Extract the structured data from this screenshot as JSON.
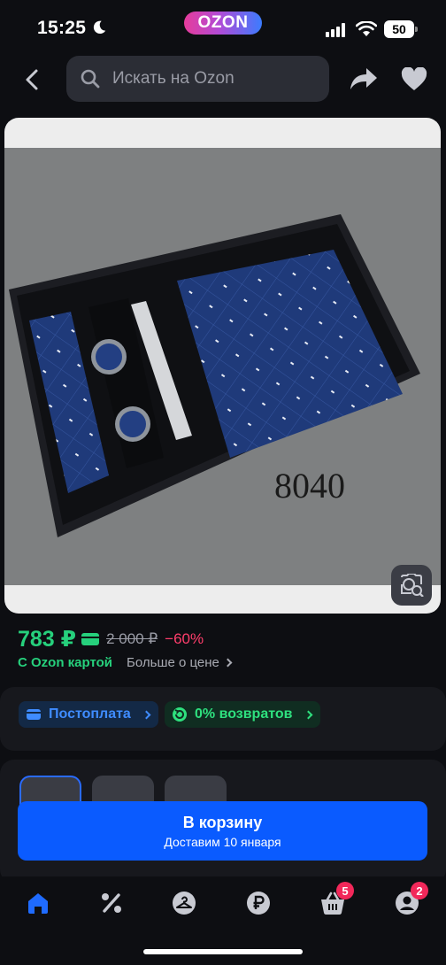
{
  "status_bar": {
    "time": "15:25",
    "brand": "OZON",
    "battery": "50",
    "icons": [
      "moon-icon",
      "signal-icon",
      "wifi-icon",
      "battery-icon"
    ]
  },
  "header": {
    "search_placeholder": "Искать на Ozon",
    "icons": [
      "back-arrow-icon",
      "search-icon",
      "share-icon",
      "heart-icon"
    ]
  },
  "product_image": {
    "overlay_text": "8040",
    "icons": [
      "image-search-icon"
    ]
  },
  "price": {
    "current": "783 ₽",
    "old": "2 000 ₽",
    "discount": "−60%",
    "card_note": "С Ozon картой",
    "more_link": "Больше о цене"
  },
  "badges": {
    "postpay": "Постоплата",
    "returns": "0% возвратов"
  },
  "cart": {
    "label": "В корзину",
    "delivery": "Доставим 10 января"
  },
  "bottom_nav": {
    "cart_count": "5",
    "profile_count": "2",
    "icons": [
      "home-icon",
      "percent-icon",
      "hanger-icon",
      "ruble-icon",
      "basket-icon",
      "profile-icon"
    ]
  },
  "colors": {
    "price_green": "#26d07c",
    "discount_red": "#ff3e6c",
    "accent_blue": "#0a5bff",
    "badge_pink": "#f2285a",
    "background": "#0d0e12"
  }
}
